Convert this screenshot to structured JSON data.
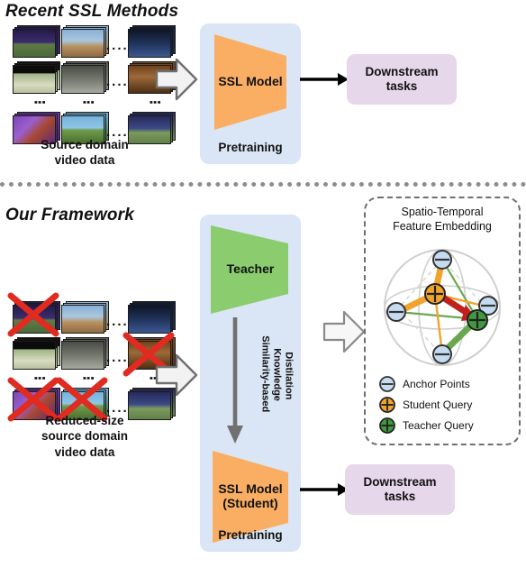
{
  "figure": {
    "type": "diagram",
    "description": "Two-panel comparison diagram: Recent SSL Methods versus Our Framework for self-supervised video representation learning with knowledge distillation."
  },
  "colors": {
    "panel_blue": "#dae6f5",
    "model_orange": "#f9ae63",
    "teacher_green": "#8bcc6e",
    "downstream_purple": "#e6d7ea",
    "arrow_gray": "#6f6f6f",
    "block_arrow_fill": "#f2f2f2",
    "distill_arrow": "#707070",
    "red_arrow": "#c0201e",
    "cross_red": "#e02b20",
    "anchor_blue": "#c5dcf0",
    "student_orange": "#f2a32c",
    "teacher_marker_green": "#3f9a3f",
    "divider_dots": "#8d8d8d"
  },
  "top_panel": {
    "title": "Recent SSL Methods",
    "data_caption": "Source domain\nvideo data",
    "data_caption_lines": [
      "Source domain",
      "video data"
    ],
    "block_arrow": "block-arrow-right",
    "pretraining_label": "Pretraining",
    "model_label": "SSL Model",
    "downstream_label": "Downstream\ntasks",
    "downstream_lines": [
      "Downstream",
      "tasks"
    ]
  },
  "bottom_panel": {
    "title": "Our Framework",
    "data_caption_lines": [
      "Reduced-size",
      "source domain",
      "video data"
    ],
    "block_arrow": "block-arrow-right",
    "pretraining_label": "Pretraining",
    "teacher_label": "Teacher",
    "student_label_lines": [
      "SSL Model",
      "(Student)"
    ],
    "distillation_label_lines": [
      "Similarity-based",
      "Knowledge",
      "Distilation"
    ],
    "downstream_lines": [
      "Downstream",
      "tasks"
    ]
  },
  "embedding_box": {
    "title_lines": [
      "Spatio-Temporal",
      "Feature Embedding"
    ],
    "legend": [
      {
        "marker": "anchor-point-marker",
        "label": "Anchor Points"
      },
      {
        "marker": "student-query-marker",
        "label": "Student Query"
      },
      {
        "marker": "teacher-query-marker",
        "label": "Teacher Query"
      }
    ],
    "anchor_count": 4,
    "queries": [
      "Student Query",
      "Teacher Query"
    ],
    "alignment_arrow": "student-to-teacher-arrow"
  },
  "video_grid": {
    "rows": 3,
    "cols": 3,
    "ellipsis": "....",
    "vertical_ellipsis": "⋮",
    "crossed_out_cells_bottom_panel": [
      0,
      5,
      6,
      7
    ]
  }
}
